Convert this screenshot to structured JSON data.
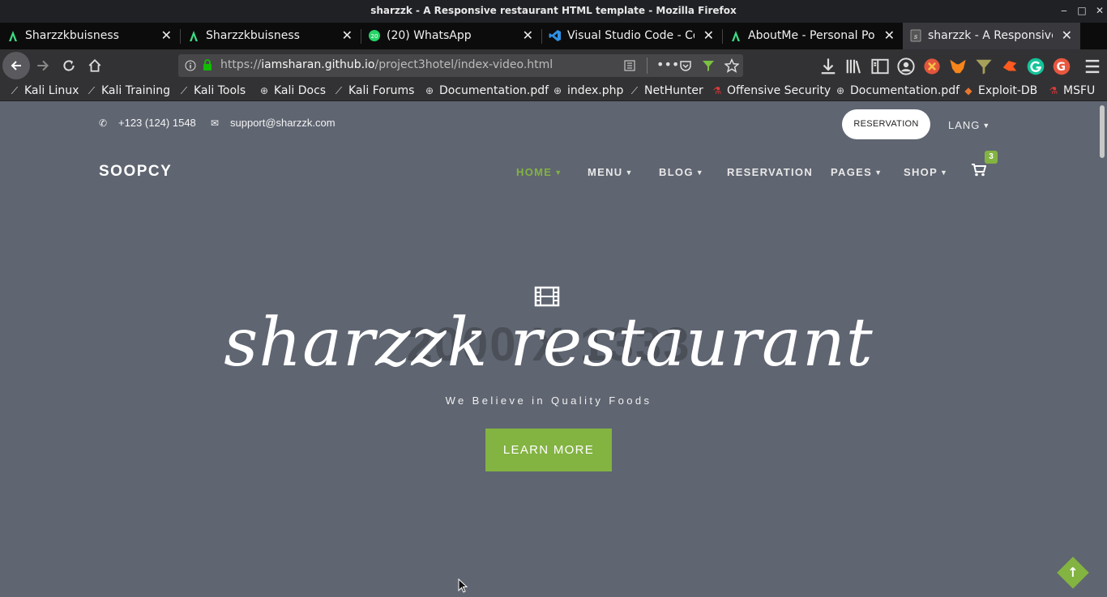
{
  "window": {
    "title": "sharzzk - A Responsive restaurant HTML template - Mozilla Firefox",
    "minimize": "‒",
    "maximize": "□",
    "close": "✕"
  },
  "tabs": [
    {
      "label": "Sharzzkbuisness",
      "icon": "android-icon",
      "active": false
    },
    {
      "label": "Sharzzkbuisness",
      "icon": "android-icon",
      "active": false
    },
    {
      "label": "(20) WhatsApp",
      "icon": "whatsapp-icon",
      "badge": "20",
      "active": false
    },
    {
      "label": "Visual Studio Code - Cod",
      "icon": "vscode-icon",
      "active": false
    },
    {
      "label": "AboutMe - Personal Port",
      "icon": "android-icon",
      "active": false
    },
    {
      "label": "sharzzk - A Responsive r",
      "icon": "page-icon",
      "active": true
    }
  ],
  "tab_close": "✕",
  "new_tab": "+",
  "navbar": {
    "url_prefix": "https://",
    "url_domain": "iamsharan.github.io",
    "url_path": "/project3hotel/index-video.html"
  },
  "bookmarks": [
    {
      "label": "Kali Linux",
      "icon": "kali-icon"
    },
    {
      "label": "Kali Training",
      "icon": "kali-icon"
    },
    {
      "label": "Kali Tools",
      "icon": "kali-icon"
    },
    {
      "label": "Kali Docs",
      "icon": "globe-icon"
    },
    {
      "label": "Kali Forums",
      "icon": "kali-icon"
    },
    {
      "label": "Documentation.pdf",
      "icon": "globe-icon"
    },
    {
      "label": "index.php",
      "icon": "globe-icon"
    },
    {
      "label": "NetHunter",
      "icon": "kali-icon"
    },
    {
      "label": "Offensive Security",
      "icon": "offsec-icon"
    },
    {
      "label": "Documentation.pdf",
      "icon": "globe-icon"
    },
    {
      "label": "Exploit-DB",
      "icon": "exploitdb-icon"
    },
    {
      "label": "MSFU",
      "icon": "offsec-icon"
    }
  ],
  "site": {
    "phone": "+123 (124) 1548",
    "email": "support@sharzzk.com",
    "reservation_button": "RESERVATION",
    "lang": "LANG",
    "logo": "SOOPCY",
    "menu": [
      {
        "label": "HOME",
        "dropdown": true,
        "active": true
      },
      {
        "label": "MENU",
        "dropdown": true,
        "active": false
      },
      {
        "label": "BLOG",
        "dropdown": true,
        "active": false
      },
      {
        "label": "RESERVATION",
        "dropdown": false,
        "active": false
      },
      {
        "label": "PAGES",
        "dropdown": true,
        "active": false
      },
      {
        "label": "SHOP",
        "dropdown": true,
        "active": false
      }
    ],
    "cart_count": "3",
    "hero": {
      "watermark": "2000 X 1333",
      "title": "sharzzk restaurant",
      "subtitle": "We Believe in Quality Foods",
      "button": "LEARN MORE"
    }
  },
  "colors": {
    "accent": "#83b341",
    "page_bg": "#5f6571",
    "tabbar_bg": "#0c0c0d",
    "toolbar_bg": "#323234"
  }
}
